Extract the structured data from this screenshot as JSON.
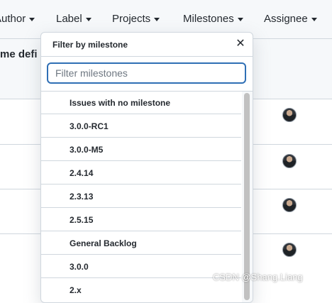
{
  "filterbar": {
    "author": "Author",
    "label": "Label",
    "projects": "Projects",
    "milestones": "Milestones",
    "assignee": "Assignee"
  },
  "subheader": {
    "title_fragment": "me defi"
  },
  "dropdown": {
    "title": "Filter by milestone",
    "close_glyph": "✕",
    "search_placeholder": "Filter milestones",
    "items": [
      "Issues with no milestone",
      "3.0.0-RC1",
      "3.0.0-M5",
      "2.4.14",
      "2.3.13",
      "2.5.15",
      "General Backlog",
      "3.0.0",
      "2.x"
    ]
  },
  "watermark": "CSDN @Shang.Liang",
  "icons": {
    "avatar": "user-avatar-icon",
    "caret": "caret-down-icon",
    "close": "close-icon"
  }
}
